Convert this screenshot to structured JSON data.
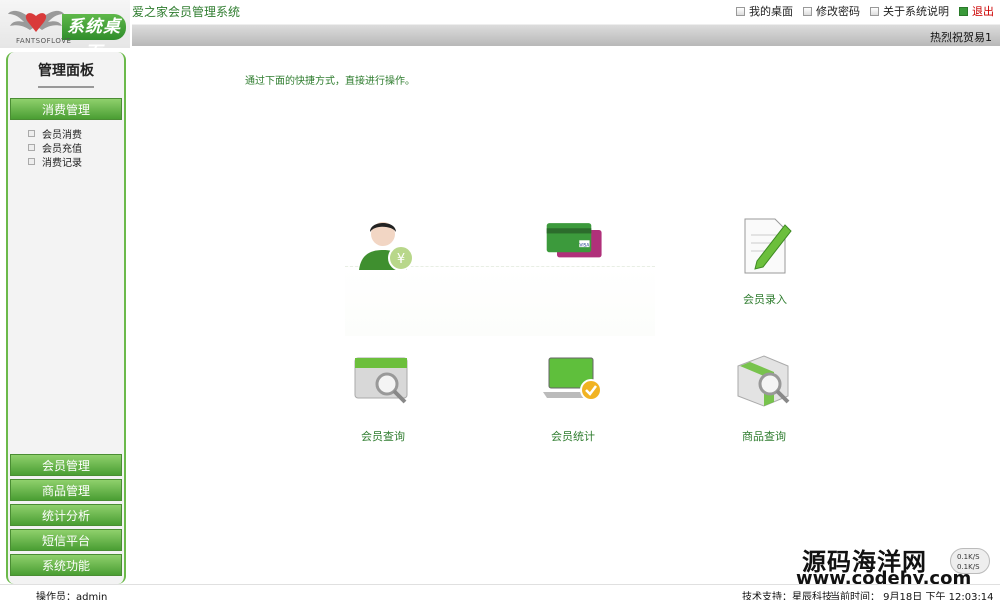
{
  "header": {
    "logo_text": "系统桌面",
    "logo_sub": "FANTSOFLOVE",
    "app_title": "爱之家会员管理系统",
    "links": [
      {
        "label": "我的桌面",
        "icon": "desktop-icon"
      },
      {
        "label": "修改密码",
        "icon": "key-icon"
      },
      {
        "label": "关于系统说明",
        "icon": "info-icon"
      },
      {
        "label": "退出",
        "icon": "exit-icon"
      }
    ],
    "greeting": "热烈祝贺易1"
  },
  "sidebar": {
    "panel_title": "管理面板",
    "active_section": "消费管理",
    "sub_items": [
      "会员消费",
      "会员充值",
      "消费记录"
    ],
    "bottom_sections": [
      "会员管理",
      "商品管理",
      "统计分析",
      "短信平台",
      "系统功能"
    ]
  },
  "main": {
    "instruction": "通过下面的快捷方式，直接进行操作。",
    "tiles": [
      {
        "label": "",
        "icon": "member-consume-icon"
      },
      {
        "label": "",
        "icon": "member-recharge-card-icon"
      },
      {
        "label": "会员录入",
        "icon": "member-entry-document-icon"
      },
      {
        "label": "会员查询",
        "icon": "member-query-icon"
      },
      {
        "label": "会员统计",
        "icon": "member-statistics-laptop-icon"
      },
      {
        "label": "商品查询",
        "icon": "product-query-box-icon"
      }
    ]
  },
  "footer": {
    "operator": "操作员：admin",
    "support": "技术支持：星辰科技",
    "current_time": "当前时间： 9月18日 下午 12:03:14"
  },
  "watermark": {
    "line1": "源码海洋网",
    "line2": "www.codehy.com",
    "net_up": "0.1K/S",
    "net_down": "0.1K/S"
  },
  "colors": {
    "accent": "#4a9e33",
    "title_green": "#2f7d2f",
    "exit_red": "#cc0000"
  }
}
